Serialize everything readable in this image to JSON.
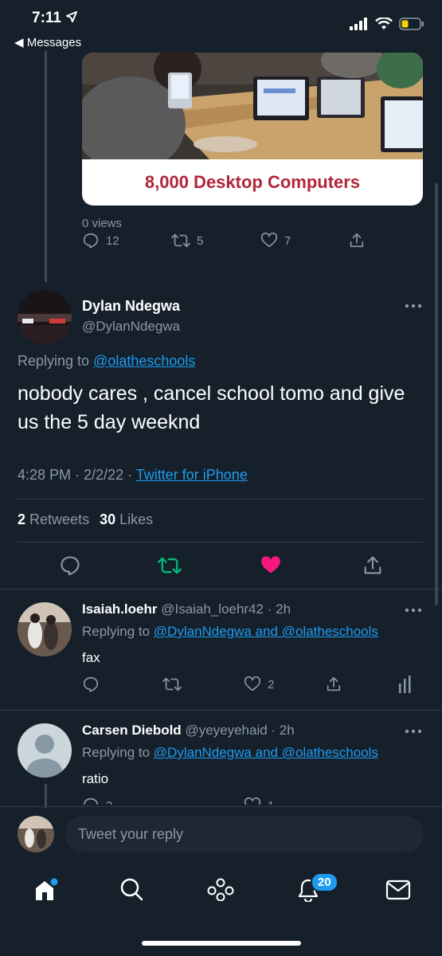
{
  "status_bar": {
    "time": "7:11",
    "back_label": "◀ Messages"
  },
  "colors": {
    "background": "#15202b",
    "accent": "#1d9bf0",
    "retweet_green": "#00ba7c",
    "like_pink": "#f91880",
    "muted": "#8b98a5"
  },
  "media": {
    "caption": "8,000 Desktop Computers"
  },
  "quoted_tweet": {
    "views": "0 views",
    "replies": "12",
    "retweets": "5",
    "likes": "7"
  },
  "main_tweet": {
    "name": "Dylan Ndegwa",
    "handle": "@DylanNdegwa",
    "replying_prefix": "Replying to",
    "replying_to": "@olatheschools",
    "text": "nobody cares , cancel school tomo and give us the 5 day weeknd",
    "time": "4:28 PM · 2/2/22 ·",
    "source": "Twitter for iPhone",
    "retweet_count": "2",
    "retweet_label": "Retweets",
    "like_count": "30",
    "like_label": "Likes",
    "more_icon": "more-icon"
  },
  "replies": [
    {
      "name": "Isaiah.loehr",
      "handle_time": "@Isaiah_loehr42 · 2h",
      "replying_prefix": "Replying to",
      "replying_to": "@DylanNdegwa and @olatheschools",
      "text": "fax",
      "likes": "2"
    },
    {
      "name": "Carsen Diebold",
      "handle_time": "@yeyeyehaid · 2h",
      "replying_prefix": "Replying to",
      "replying_to": "@DylanNdegwa and @olatheschools",
      "text": "ratio",
      "replies": "2",
      "likes": "1"
    }
  ],
  "compose": {
    "placeholder": "Tweet your reply"
  },
  "tabbar": {
    "notifications_badge": "20",
    "tabs": [
      "home-icon",
      "search-icon",
      "spaces-icon",
      "notifications-icon",
      "messages-icon"
    ]
  }
}
